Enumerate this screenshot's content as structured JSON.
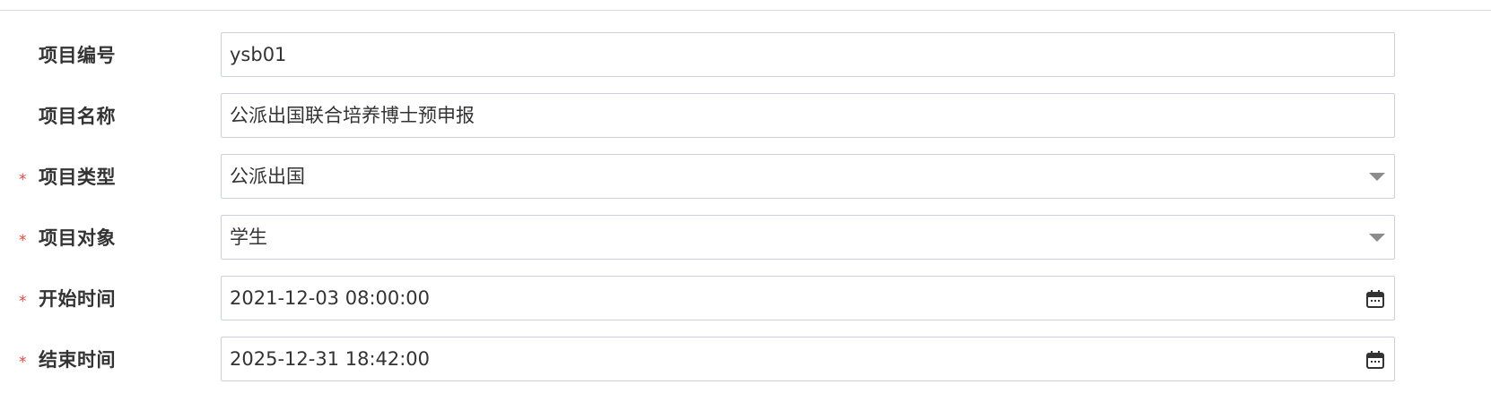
{
  "fields": {
    "project_code": {
      "label": "项目编号",
      "value": "ysb01"
    },
    "project_name": {
      "label": "项目名称",
      "value": "公派出国联合培养博士预申报"
    },
    "project_type": {
      "required_mark": "*",
      "label": "项目类型",
      "value": "公派出国",
      "icon": "chevron-down-icon"
    },
    "project_target": {
      "required_mark": "*",
      "label": "项目对象",
      "value": "学生",
      "icon": "chevron-down-icon"
    },
    "start_time": {
      "required_mark": "*",
      "label": "开始时间",
      "value": "2021-12-03 08:00:00",
      "icon": "calendar-icon"
    },
    "end_time": {
      "required_mark": "*",
      "label": "结束时间",
      "value": "2025-12-31 18:42:00",
      "icon": "calendar-icon"
    }
  },
  "colors": {
    "required": "#e5483c",
    "border": "#cbd0e0",
    "text": "#333333",
    "divider": "#d9d9d9"
  }
}
